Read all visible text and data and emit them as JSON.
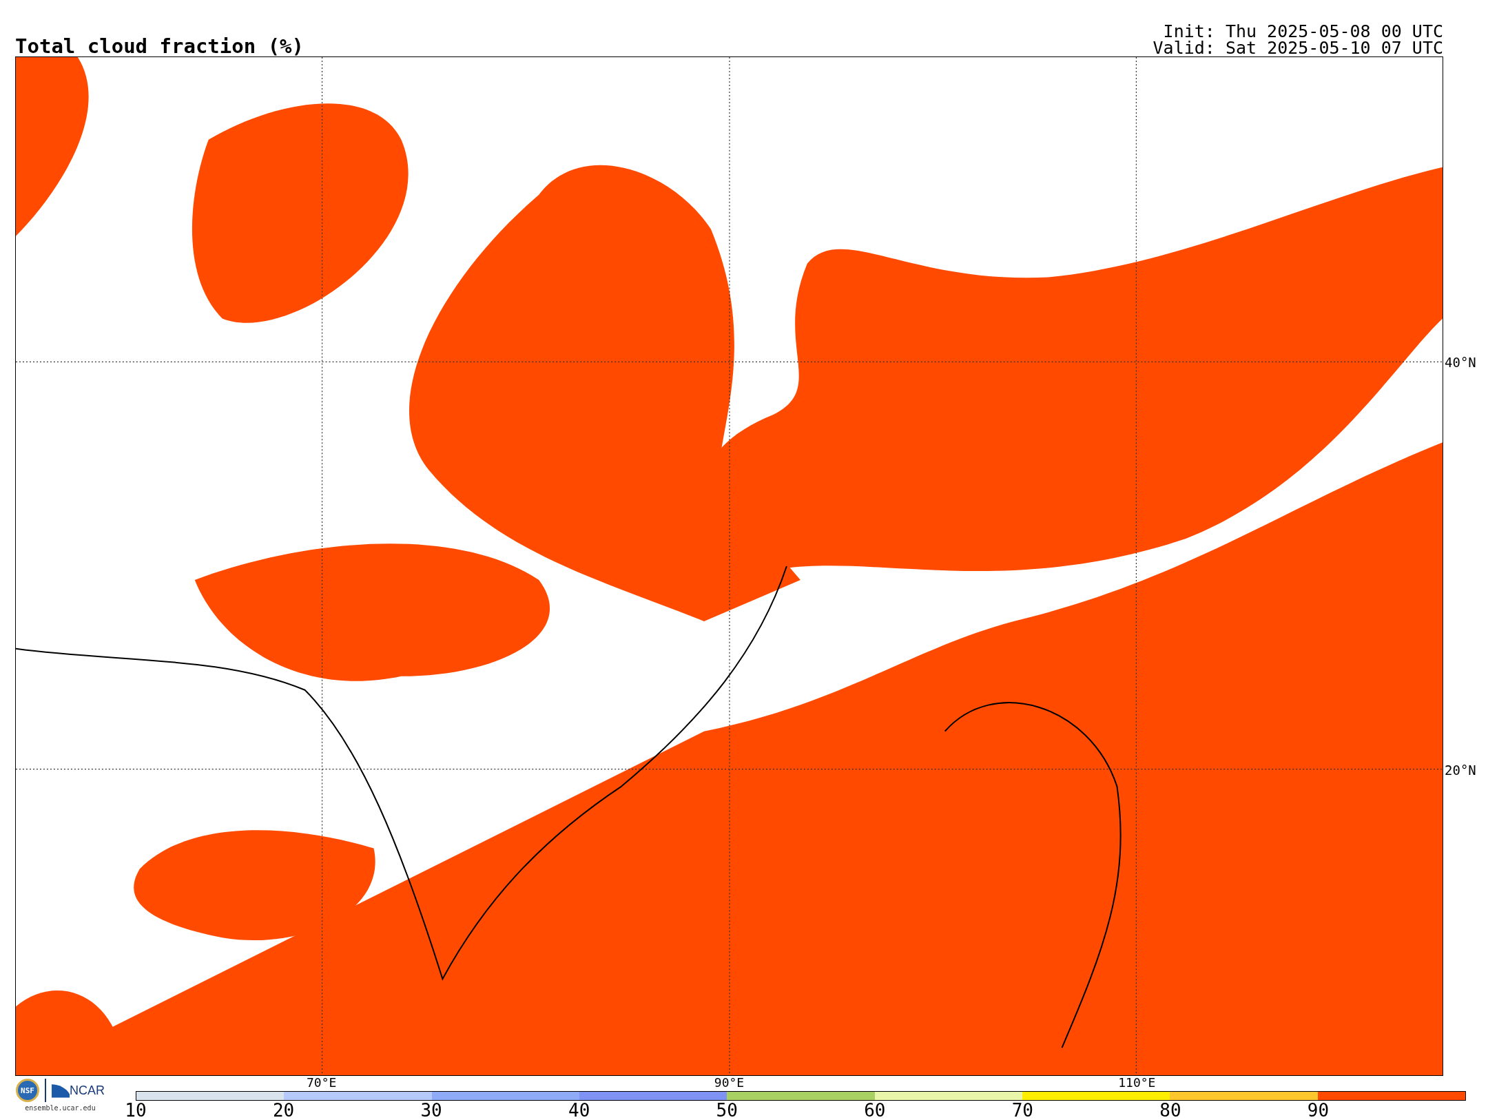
{
  "title": "Total cloud fraction (%)",
  "init": "Init: Thu 2025-05-08 00 UTC",
  "valid": "Valid: Sat 2025-05-10 07 UTC",
  "map": {
    "lat_labels": [
      {
        "label": "40°N"
      },
      {
        "label": "20°N"
      }
    ],
    "lon_labels": [
      {
        "label": "70°E"
      },
      {
        "label": "90°E"
      },
      {
        "label": "110°E"
      }
    ]
  },
  "logo": {
    "nsf": "NSF",
    "ncar": "NCAR",
    "url": "ensemble.ucar.edu"
  },
  "colorbar": {
    "ticks": [
      "10",
      "20",
      "30",
      "40",
      "50",
      "60",
      "70",
      "80",
      "90"
    ],
    "segments": [
      {
        "color": "#d8e3ee"
      },
      {
        "color": "#b5c9fa"
      },
      {
        "color": "#8fabf8"
      },
      {
        "color": "#7f93f5"
      },
      {
        "color": "#a9d063"
      },
      {
        "color": "#e9f6a9"
      },
      {
        "color": "#ffee00"
      },
      {
        "color": "#ffc72e"
      },
      {
        "color": "#ff4a00"
      }
    ]
  }
}
